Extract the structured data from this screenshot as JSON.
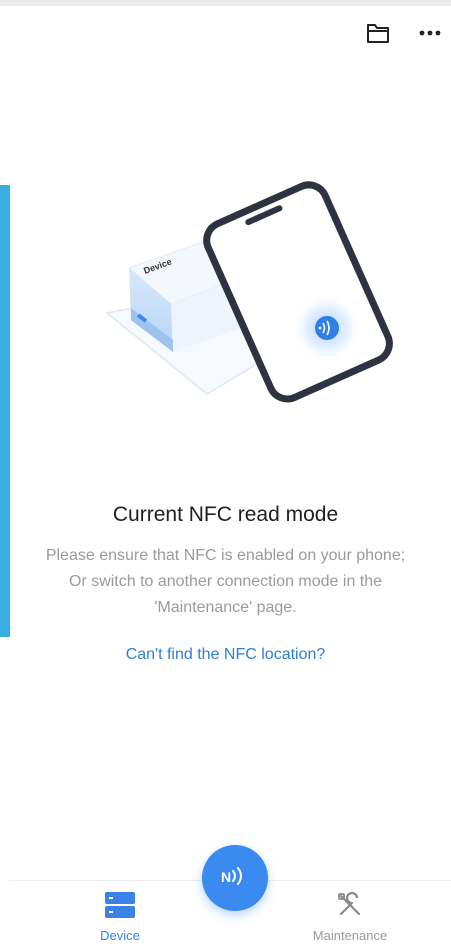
{
  "header": {
    "folder_icon": "folder-icon",
    "more_icon": "more-icon"
  },
  "illustration": {
    "device_label": "Device"
  },
  "main": {
    "title": "Current NFC read mode",
    "description_lines": [
      "Please ensure that NFC is enabled on your phone;",
      "Or switch to another connection mode in the 'Maintenance' page."
    ],
    "link": "Can't find the NFC location?"
  },
  "bottom_nav": {
    "items": [
      {
        "label": "Device",
        "icon": "device-icon",
        "active": true
      },
      {
        "label": "Maintenance",
        "icon": "maintenance-icon",
        "active": false
      }
    ],
    "fab_icon": "nfc-icon"
  },
  "colors": {
    "accent": "#3a8af0",
    "link": "#2f7fd6",
    "left_strip": "#3aaee3"
  }
}
